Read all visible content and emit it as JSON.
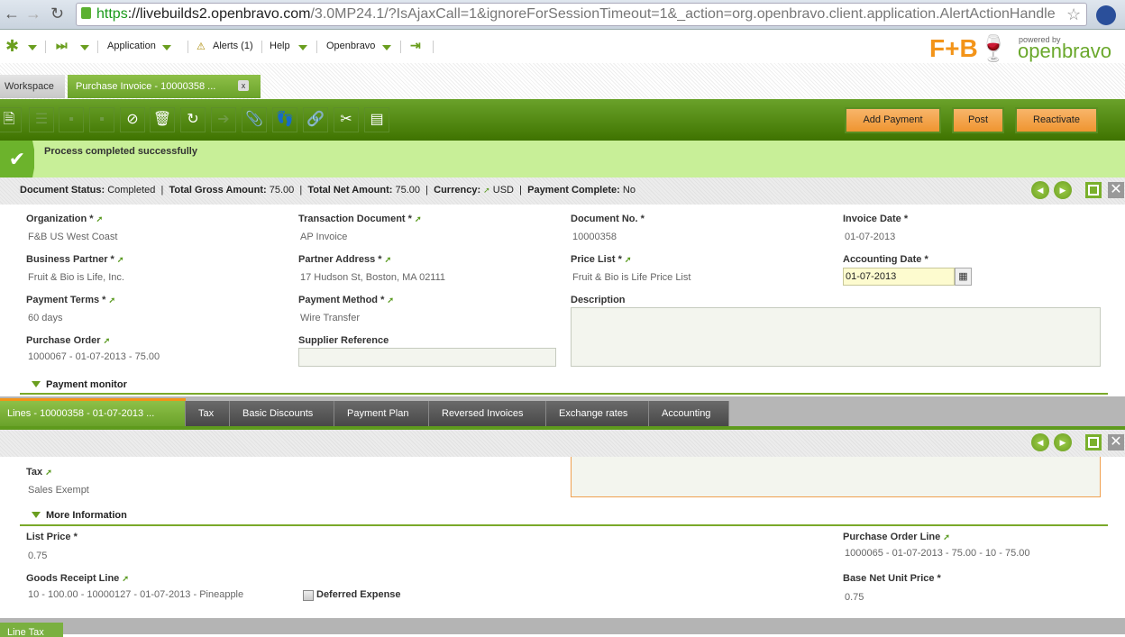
{
  "browser": {
    "url_scheme": "https",
    "url_domain": "://livebuilds2.openbravo.com",
    "url_path": "/3.0MP24.1/?IsAjaxCall=1&ignoreForSessionTimeout=1&_action=org.openbravo.client.application.AlertActionHandle"
  },
  "menu": {
    "application": "Application",
    "alerts": "Alerts (1)",
    "help": "Help",
    "user": "Openbravo"
  },
  "logo": {
    "brand": "F+B",
    "powered": "powered by",
    "name": "openbravo"
  },
  "tabs": [
    {
      "label": "Workspace"
    },
    {
      "label": "Purchase Invoice - 10000358 ...",
      "close": "x"
    }
  ],
  "toolbar": {
    "buttons": [
      "Add Payment",
      "Post",
      "Reactivate"
    ]
  },
  "message": {
    "text": "Process completed successfully"
  },
  "status": {
    "doc_status_label": "Document Status:",
    "doc_status": "Completed",
    "gross_label": "Total Gross Amount:",
    "gross": "75.00",
    "net_label": "Total Net Amount:",
    "net": "75.00",
    "currency_label": "Currency:",
    "currency": "USD",
    "paid_label": "Payment Complete:",
    "paid": "No"
  },
  "form": {
    "organization": {
      "label": "Organization *",
      "value": "F&B US West Coast"
    },
    "transaction_document": {
      "label": "Transaction Document *",
      "value": "AP Invoice"
    },
    "document_no": {
      "label": "Document No. *",
      "value": "10000358"
    },
    "invoice_date": {
      "label": "Invoice Date *",
      "value": "01-07-2013"
    },
    "business_partner": {
      "label": "Business Partner *",
      "value": "Fruit & Bio is Life, Inc."
    },
    "partner_address": {
      "label": "Partner Address *",
      "value": "17 Hudson St, Boston, MA 02111"
    },
    "price_list": {
      "label": "Price List *",
      "value": "Fruit & Bio is Life Price List"
    },
    "accounting_date": {
      "label": "Accounting Date *",
      "value": "01-07-2013"
    },
    "payment_terms": {
      "label": "Payment Terms *",
      "value": "60 days"
    },
    "payment_method": {
      "label": "Payment Method *",
      "value": "Wire Transfer"
    },
    "description": {
      "label": "Description",
      "value": ""
    },
    "purchase_order": {
      "label": "Purchase Order",
      "value": "1000067 - 01-07-2013 - 75.00"
    },
    "supplier_reference": {
      "label": "Supplier Reference",
      "value": ""
    },
    "payment_monitor": "Payment monitor"
  },
  "child_tabs": [
    "Lines - 10000358 - 01-07-2013 ...",
    "Tax",
    "Basic Discounts",
    "Payment Plan",
    "Reversed Invoices",
    "Exchange rates",
    "Accounting"
  ],
  "line": {
    "tax": {
      "label": "Tax",
      "value": "Sales Exempt"
    },
    "more_info": "More Information",
    "list_price": {
      "label": "List Price *",
      "value": "0.75"
    },
    "po_line": {
      "label": "Purchase Order Line",
      "value": "1000065 - 01-07-2013 - 75.00 - 10 - 75.00"
    },
    "goods_receipt_line": {
      "label": "Goods Receipt Line",
      "value": "10 - 100.00 - 10000127 - 01-07-2013 - Pineapple"
    },
    "deferred_expense": {
      "label": "Deferred Expense",
      "checked": false
    },
    "base_net_unit_price": {
      "label": "Base Net Unit Price *",
      "value": "0.75"
    }
  },
  "bottom_tab": "Line Tax"
}
